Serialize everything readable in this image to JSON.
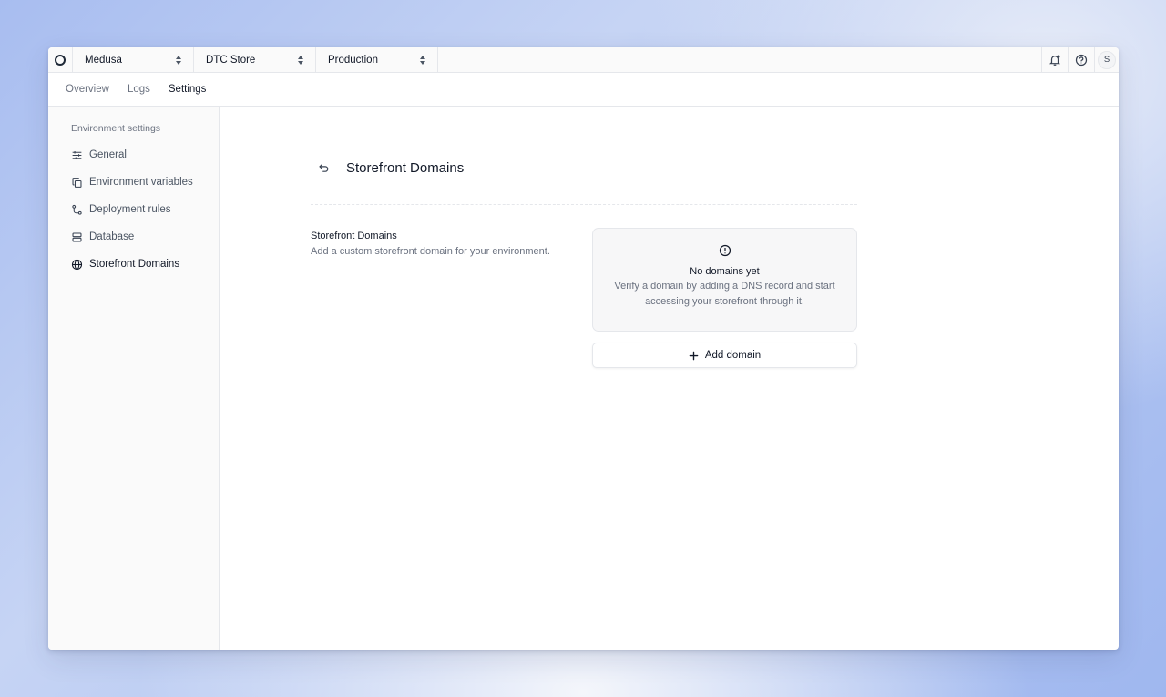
{
  "topbar": {
    "org": "Medusa",
    "project": "DTC Store",
    "environment": "Production",
    "avatar_initial": "S"
  },
  "tabs": [
    "Overview",
    "Logs",
    "Settings"
  ],
  "active_tab": "Settings",
  "sidebar": {
    "title": "Environment settings",
    "items": [
      {
        "label": "General",
        "icon": "sliders-icon"
      },
      {
        "label": "Environment variables",
        "icon": "copy-icon"
      },
      {
        "label": "Deployment rules",
        "icon": "git-branch-icon"
      },
      {
        "label": "Database",
        "icon": "database-icon"
      },
      {
        "label": "Storefront Domains",
        "icon": "globe-icon"
      }
    ],
    "active": "Storefront Domains"
  },
  "page": {
    "title": "Storefront Domains",
    "section_title": "Storefront Domains",
    "section_description": "Add a custom storefront domain for your environment.",
    "empty_title": "No domains yet",
    "empty_text": "Verify a domain by adding a DNS record and start accessing your storefront through it.",
    "add_button": "Add domain"
  }
}
